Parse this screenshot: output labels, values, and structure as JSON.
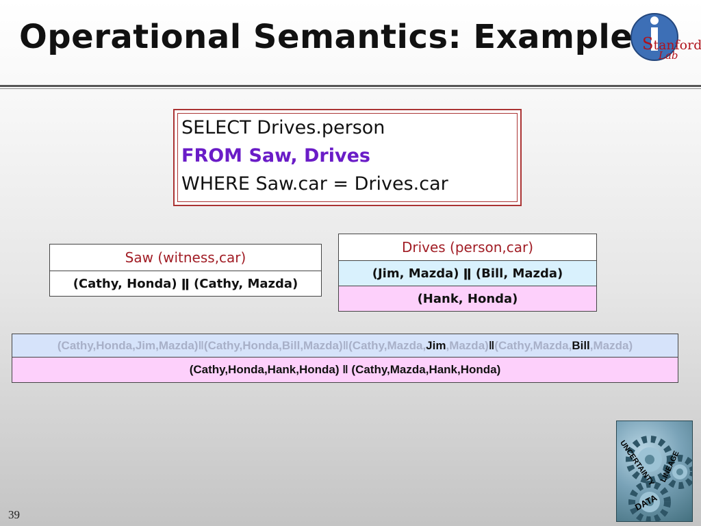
{
  "title": "Operational Semantics: Example",
  "logo": {
    "cap": "S",
    "text": "tanford",
    "sub": "Lab"
  },
  "sql": {
    "line1": "SELECT Drives.person",
    "line2": "FROM Saw, Drives",
    "line3": "WHERE Saw.car = Drives.car"
  },
  "saw": {
    "header": "Saw (witness,car)",
    "row1": "(Cathy, Honda) ǁ (Cathy, Mazda)"
  },
  "drives": {
    "header": "Drives (person,car)",
    "row1": "(Jim, Mazda) ǁ (Bill, Mazda)",
    "row2": "(Hank, Honda)"
  },
  "result": {
    "row1": {
      "p1": "(Cathy,Honda,Jim,Mazda)ǁ(Cathy,Honda,Bill,Mazda)ǁ(Cathy,Mazda,",
      "jim": "Jim",
      "p2": ",Mazda)",
      "sep": "ǁ",
      "p3": "(Cathy,Mazda,",
      "bill": "Bill",
      "p4": ",Mazda)"
    },
    "row2": "(Cathy,Honda,Hank,Honda) ǁ (Cathy,Mazda,Hank,Honda)"
  },
  "gears_words": {
    "w1": "UNCERTAINTY",
    "w2": "LINEAGE",
    "w3": "DATA"
  },
  "page_number": "39",
  "colors": {
    "from_keyword": "#6a1cc7",
    "header_text": "#a11d25",
    "blue_row": "#d9f1fd",
    "pink_row": "#fdd0fb"
  }
}
